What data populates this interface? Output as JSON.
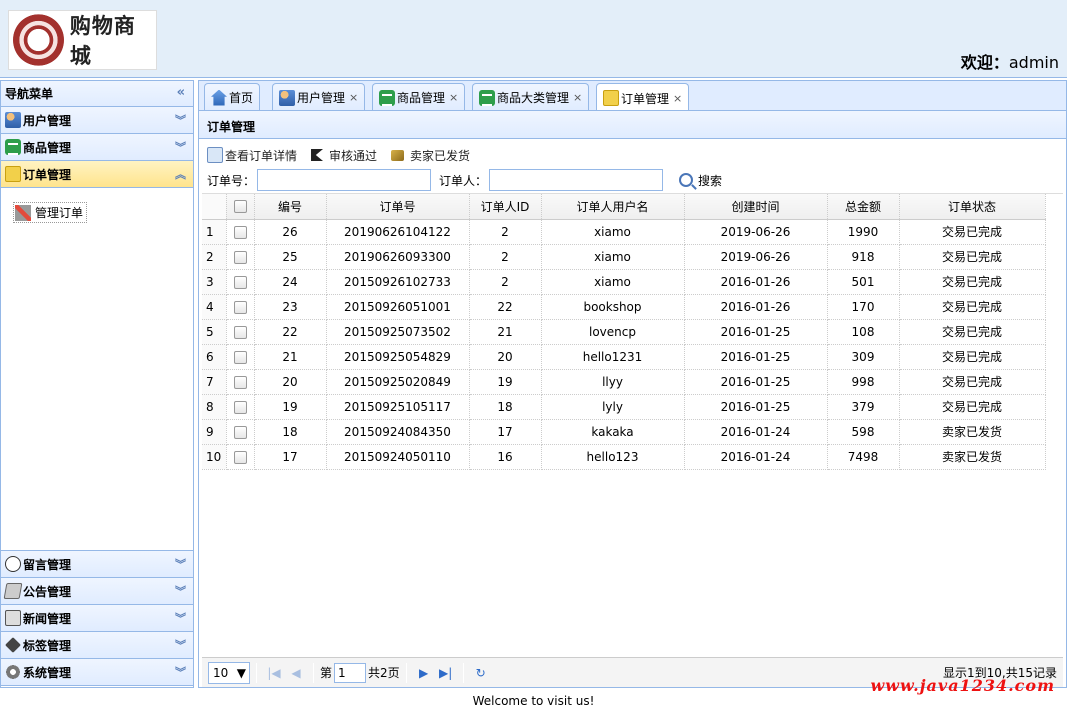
{
  "header": {
    "logo_text": "购物商城",
    "welcome_label": "欢迎：",
    "username": "admin"
  },
  "nav": {
    "title": "导航菜单",
    "sections": [
      {
        "label": "用户管理",
        "icon": "users-icon"
      },
      {
        "label": "商品管理",
        "icon": "goods-icon"
      },
      {
        "label": "订单管理",
        "icon": "order-icon",
        "active": true
      },
      {
        "label": "留言管理",
        "icon": "message-icon"
      },
      {
        "label": "公告管理",
        "icon": "notice-icon"
      },
      {
        "label": "新闻管理",
        "icon": "news-icon"
      },
      {
        "label": "标签管理",
        "icon": "tag-icon"
      },
      {
        "label": "系统管理",
        "icon": "settings-icon"
      }
    ],
    "active_item": "管理订单"
  },
  "tabs": [
    {
      "label": "首页",
      "closable": false
    },
    {
      "label": "用户管理",
      "closable": true
    },
    {
      "label": "商品管理",
      "closable": true
    },
    {
      "label": "商品大类管理",
      "closable": true
    },
    {
      "label": "订单管理",
      "closable": true,
      "selected": true
    }
  ],
  "panel": {
    "title": "订单管理",
    "toolbar": {
      "view_detail": "查看订单详情",
      "approve": "审核通过",
      "shipped": "卖家已发货"
    },
    "search": {
      "order_no_label": "订单号：",
      "orderer_label": "订单人：",
      "order_no_value": "",
      "orderer_value": "",
      "button": "搜索"
    }
  },
  "grid": {
    "columns": [
      "编号",
      "订单号",
      "订单人ID",
      "订单人用户名",
      "创建时间",
      "总金额",
      "订单状态"
    ],
    "rows": [
      {
        "n": "1",
        "id": "26",
        "no": "20190626104122",
        "uid": "2",
        "uname": "xiamo",
        "time": "2019-06-26",
        "amount": "1990",
        "status": "交易已完成"
      },
      {
        "n": "2",
        "id": "25",
        "no": "20190626093300",
        "uid": "2",
        "uname": "xiamo",
        "time": "2019-06-26",
        "amount": "918",
        "status": "交易已完成"
      },
      {
        "n": "3",
        "id": "24",
        "no": "20150926102733",
        "uid": "2",
        "uname": "xiamo",
        "time": "2016-01-26",
        "amount": "501",
        "status": "交易已完成"
      },
      {
        "n": "4",
        "id": "23",
        "no": "20150926051001",
        "uid": "22",
        "uname": "bookshop",
        "time": "2016-01-26",
        "amount": "170",
        "status": "交易已完成"
      },
      {
        "n": "5",
        "id": "22",
        "no": "20150925073502",
        "uid": "21",
        "uname": "lovencp",
        "time": "2016-01-25",
        "amount": "108",
        "status": "交易已完成"
      },
      {
        "n": "6",
        "id": "21",
        "no": "20150925054829",
        "uid": "20",
        "uname": "hello1231",
        "time": "2016-01-25",
        "amount": "309",
        "status": "交易已完成"
      },
      {
        "n": "7",
        "id": "20",
        "no": "20150925020849",
        "uid": "19",
        "uname": "llyy",
        "time": "2016-01-25",
        "amount": "998",
        "status": "交易已完成"
      },
      {
        "n": "8",
        "id": "19",
        "no": "20150925105117",
        "uid": "18",
        "uname": "lyly",
        "time": "2016-01-25",
        "amount": "379",
        "status": "交易已完成"
      },
      {
        "n": "9",
        "id": "18",
        "no": "20150924084350",
        "uid": "17",
        "uname": "kakaka",
        "time": "2016-01-24",
        "amount": "598",
        "status": "卖家已发货"
      },
      {
        "n": "10",
        "id": "17",
        "no": "20150924050110",
        "uid": "16",
        "uname": "hello123",
        "time": "2016-01-24",
        "amount": "7498",
        "status": "卖家已发货"
      }
    ]
  },
  "pager": {
    "page_size": "10",
    "page_prefix": "第",
    "current_page": "1",
    "total_pages": "共2页",
    "info": "显示1到10,共15记录"
  },
  "footer": {
    "text": "Welcome to visit us!",
    "watermark": "www.java1234.com"
  }
}
